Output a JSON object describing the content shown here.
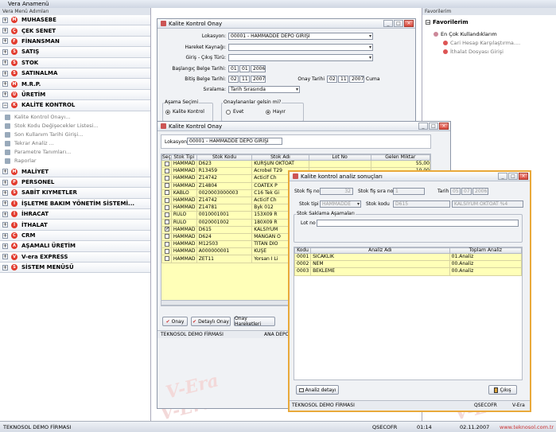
{
  "app": {
    "title": "Vera Anamenü"
  },
  "menu": {
    "header": "Vera Menü Adımları",
    "items_top": [
      {
        "label": "MUHASEBE",
        "icon": "M"
      },
      {
        "label": "ÇEK SENET",
        "icon": "Ç"
      },
      {
        "label": "FİNANSMAN",
        "icon": "F"
      },
      {
        "label": "SATIŞ",
        "icon": "S"
      },
      {
        "label": "STOK",
        "icon": "S"
      },
      {
        "label": "SATINALMA",
        "icon": "S"
      },
      {
        "label": "M.R.P.",
        "icon": "M"
      },
      {
        "label": "ÜRETİM",
        "icon": "Ü"
      },
      {
        "label": "KALİTE KONTROL",
        "icon": "K"
      }
    ],
    "sub_items": [
      "Kalite Kontrol Onayı...",
      "Stok Kodu Değişecekler Listesi...",
      "Son Kullanım Tarihi Girişi...",
      "Tekrar Analiz ...",
      "Parametre Tanımları...",
      "Raporlar"
    ],
    "items_bottom": [
      {
        "label": "MALİYET",
        "icon": "M"
      },
      {
        "label": "PERSONEL",
        "icon": "P"
      },
      {
        "label": "SABİT KIYMETLER",
        "icon": "S"
      },
      {
        "label": "İŞLETME BAKIM YÖNETİM SİSTEMİ...",
        "icon": "İ"
      },
      {
        "label": "İHRACAT",
        "icon": "İ"
      },
      {
        "label": "İTHALAT",
        "icon": "İ"
      },
      {
        "label": "CRM",
        "icon": "C"
      },
      {
        "label": "AŞAMALI ÜRETİM",
        "icon": "A"
      },
      {
        "label": "V-era EXPRESS",
        "icon": "V"
      },
      {
        "label": "SİSTEM MENÜSÜ",
        "icon": "S"
      }
    ]
  },
  "favorites": {
    "header": "Favorilerim",
    "root": "Favorilerim",
    "group": "En Çok Kullandıklarım",
    "items": [
      "Cari Hesap Karşılaştırma....",
      "İthalat Dosyası Girişi"
    ]
  },
  "w1": {
    "title": "Kalite Kontrol Onay",
    "lokasyon_lbl": "Lokasyon:",
    "lokasyon_val": "00001 - HAMMADDE DEPO GİRİŞİ",
    "hareket_lbl": "Hareket Kaynağı:",
    "giris_lbl": "Giriş - Çıkış Türü:",
    "bas_lbl": "Başlangıç Belge Tarihi:",
    "bas_d": "01",
    "bas_m": "01",
    "bas_y": "2006",
    "bit_lbl": "Bitiş Belge Tarihi:",
    "bit_d": "02",
    "bit_m": "11",
    "bit_y": "2007",
    "onay_lbl": "Onay Tarihi",
    "onay_d": "02",
    "onay_m": "11",
    "onay_y": "2007",
    "onay_day": "Cuma",
    "sirala_lbl": "Sıralama:",
    "sirala_val": "Tarih Sırasında",
    "asama_lbl": "Aşama Seçimi",
    "asama_opt": "Kalite Kontrol",
    "onaylanan_lbl": "Onaylananlar gelsin mi?",
    "evet": "Evet",
    "hayir": "Hayır"
  },
  "w2": {
    "title": "Kalite Kontrol Onay",
    "lokasyon_lbl": "Lokasyon:",
    "lokasyon_val": "00001 - HAMMADDE DEPO GİRİŞİ",
    "headers": [
      "Seç",
      "Stok Tipi",
      "Stok Kodu",
      "Stok Adı",
      "Lot No",
      "Gelen Miktar"
    ],
    "rows": [
      {
        "sel": "",
        "tip": "HAMMAD",
        "kod": "D623",
        "ad": "KURŞUN OKTOAT",
        "lot": "",
        "miktar": "55,00"
      },
      {
        "sel": "",
        "tip": "HAMMAD",
        "kod": "R13459",
        "ad": "Acrobel T29",
        "lot": "",
        "miktar": "10,00"
      },
      {
        "sel": "",
        "tip": "HAMMAD",
        "kod": "Z14742",
        "ad": "Acticif Ch",
        "lot": "",
        "miktar": ""
      },
      {
        "sel": "",
        "tip": "HAMMAD",
        "kod": "Z14804",
        "ad": "COATEX P",
        "lot": "",
        "miktar": ""
      },
      {
        "sel": "",
        "tip": "KABLO",
        "kod": "0020003000003",
        "ad": "C16 Tek Gi",
        "lot": "",
        "miktar": ""
      },
      {
        "sel": "",
        "tip": "HAMMAD",
        "kod": "Z14742",
        "ad": "Acticif Ch",
        "lot": "",
        "miktar": ""
      },
      {
        "sel": "",
        "tip": "HAMMAD",
        "kod": "Z14781",
        "ad": "Byk 012",
        "lot": "",
        "miktar": ""
      },
      {
        "sel": "",
        "tip": "RULO",
        "kod": "0010001001",
        "ad": "153X09 R",
        "lot": "",
        "miktar": ""
      },
      {
        "sel": "",
        "tip": "RULO",
        "kod": "0020001002",
        "ad": "180X09 R",
        "lot": "",
        "miktar": ""
      },
      {
        "sel": "✔",
        "tip": "HAMMAD",
        "kod": "D615",
        "ad": "KALSİYUM",
        "lot": "",
        "miktar": ""
      },
      {
        "sel": "",
        "tip": "HAMMAD",
        "kod": "D624",
        "ad": "MANGAN O",
        "lot": "",
        "miktar": ""
      },
      {
        "sel": "",
        "tip": "HAMMAD",
        "kod": "M12503",
        "ad": "TİTAN DİO",
        "lot": "",
        "miktar": ""
      },
      {
        "sel": "",
        "tip": "HAMMAD",
        "kod": "A000000001",
        "ad": "KUŞE",
        "lot": "",
        "miktar": ""
      },
      {
        "sel": "",
        "tip": "HAMMAD",
        "kod": "ZET11",
        "ad": "Yorsan I Li",
        "lot": "",
        "miktar": ""
      }
    ],
    "btn_onay": "Onay",
    "btn_detayli": "Detaylı Onay",
    "btn_hareket": "Onay Hareketleri",
    "status_left": "TEKNOSOL DEMO FİRMASI",
    "status_right": "ANA DEPO"
  },
  "w3": {
    "title": "Kalite kontrol analiz sonuçları",
    "fis_lbl": "Stok fiş no",
    "fis_val": "32",
    "sira_lbl": "Stok fiş sıra no",
    "sira_val": "1",
    "tarih_lbl": "Tarih",
    "tarih_d": "05",
    "tarih_m": "07",
    "tarih_y": "2006",
    "tip_lbl": "Stok tipi",
    "tip_val": "HAMMADDE",
    "kod_lbl": "Stok kodu",
    "kod_val": "D615",
    "kod_ad": "KALSİYUM OKTOAT %4",
    "asama_grp": "Stok Saklama Aşamaları",
    "lot_lbl": "Lot no",
    "headers": [
      "Kodu",
      "Analiz Adı",
      "Toplam Analiz"
    ],
    "rows": [
      {
        "kod": "0001",
        "ad": "SICAKLIK",
        "top": "01.Analiz"
      },
      {
        "kod": "0002",
        "ad": "NEM",
        "top": "00.Analiz"
      },
      {
        "kod": "0003",
        "ad": "BEKLEME",
        "top": "00.Analiz"
      }
    ],
    "btn_detay": "Analiz detayı",
    "btn_cikis": "Çıkış",
    "status_left": "TEKNOSOL DEMO FİRMASI",
    "status_mid": "QSECOFR",
    "status_right": "V-Era"
  },
  "watermark": "V-Era",
  "status": {
    "company": "TEKNOSOL DEMO FİRMASI",
    "user": "QSECOFR",
    "time": "01:14",
    "date": "02.11.2007",
    "site": "www.teknosol.com.tr"
  },
  "colors": {
    "accent_red": "#e23b2e",
    "grid_yellow": "#ffffb8",
    "window_bg": "#f0f2f5"
  }
}
